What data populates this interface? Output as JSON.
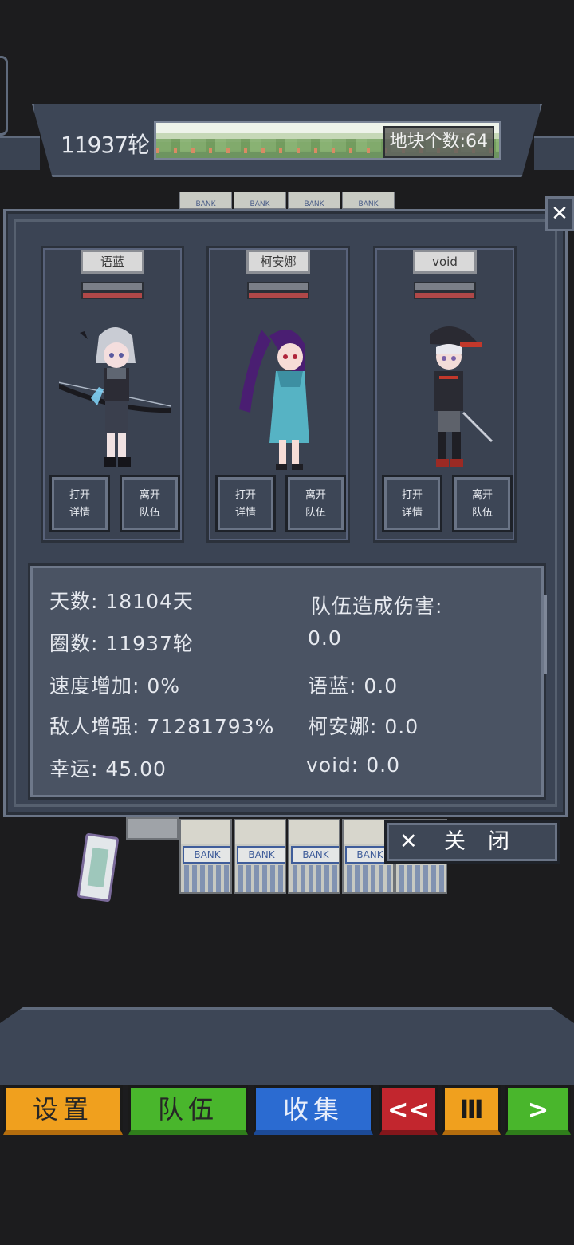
{
  "header": {
    "round_label": "11937轮",
    "tile_count_label": "地块个数:64"
  },
  "party": [
    {
      "name": "语蓝",
      "open_details_label": "打开\n详情",
      "leave_team_label": "离开\n队伍"
    },
    {
      "name": "柯安娜",
      "open_details_label": "打开\n详情",
      "leave_team_label": "离开\n队伍"
    },
    {
      "name": "void",
      "open_details_label": "打开\n详情",
      "leave_team_label": "离开\n队伍"
    }
  ],
  "stats": {
    "days": "天数: 18104天",
    "laps": "圈数: 11937轮",
    "speed_bonus": "速度增加: 0%",
    "enemy_boost": "敌人增强: 71281793%",
    "luck": "幸运: 45.00",
    "team_damage_title": "队伍造成伤害:",
    "team_damage_total": "0.0",
    "damage_yulan": "语蓝: 0.0",
    "damage_keanna": "柯安娜: 0.0",
    "damage_void": "void: 0.0"
  },
  "board": {
    "top_tile_label": "BANK",
    "tile_label": "BANK"
  },
  "dialog": {
    "close_x": "✕",
    "close_label": "关闭"
  },
  "nav": {
    "settings": "设置",
    "team": "队伍",
    "collection": "收集",
    "rewind": "<<",
    "pause": "Ⅲ",
    "play": ">"
  },
  "colors": {
    "settings_btn": "#f0a01e",
    "team_btn": "#49b62c",
    "collection_btn": "#2b6bd1",
    "rewind_btn": "#c2262e",
    "panel_bg": "#3b4454"
  }
}
